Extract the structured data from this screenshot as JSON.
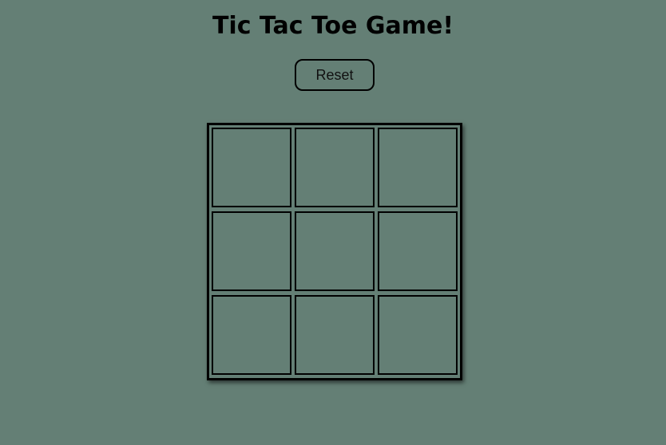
{
  "title": "Tic Tac Toe Game!",
  "reset_label": "Reset",
  "colors": {
    "background": "#647f75",
    "border": "#000000"
  },
  "board": {
    "cells": [
      "",
      "",
      "",
      "",
      "",
      "",
      "",
      "",
      ""
    ]
  }
}
